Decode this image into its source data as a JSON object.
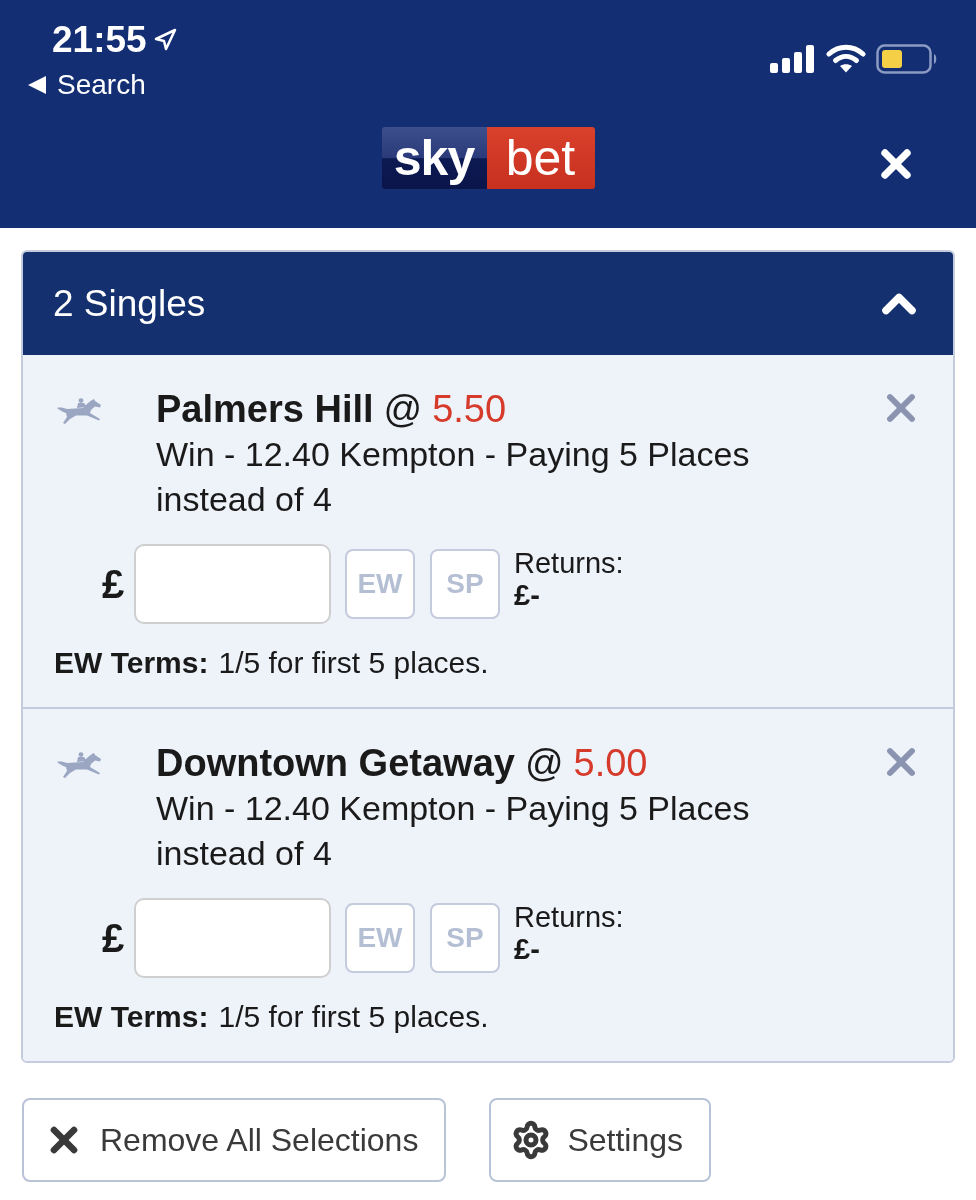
{
  "status_bar": {
    "time": "21:55",
    "back_label": "Search"
  },
  "header": {
    "logo": {
      "part_1": "sky",
      "part_2": "bet"
    }
  },
  "group": {
    "title": "2 Singles",
    "expanded": true
  },
  "bets": [
    {
      "selection": "Palmers Hill",
      "at": "@",
      "odds": "5.50",
      "market": "Win - 12.40 Kempton - Paying 5 Places instead of 4",
      "currency": "£",
      "toggles": [
        {
          "label": "EW",
          "selected": false
        },
        {
          "label": "SP",
          "selected": false
        }
      ],
      "returns_label": "Returns:",
      "returns_value": "£-",
      "terms_label": "EW Terms:",
      "terms_text": "1/5 for first 5 places."
    },
    {
      "selection": "Downtown Getaway",
      "at": "@",
      "odds": "5.00",
      "market": "Win - 12.40 Kempton - Paying 5 Places instead of 4",
      "currency": "£",
      "toggles": [
        {
          "label": "EW",
          "selected": false
        },
        {
          "label": "SP",
          "selected": false
        }
      ],
      "returns_label": "Returns:",
      "returns_value": "£-",
      "terms_label": "EW Terms:",
      "terms_text": "1/5 for first 5 places."
    }
  ],
  "actions": [
    {
      "kind": "remove",
      "label": "Remove All Selections"
    },
    {
      "kind": "settings",
      "label": "Settings"
    }
  ]
}
